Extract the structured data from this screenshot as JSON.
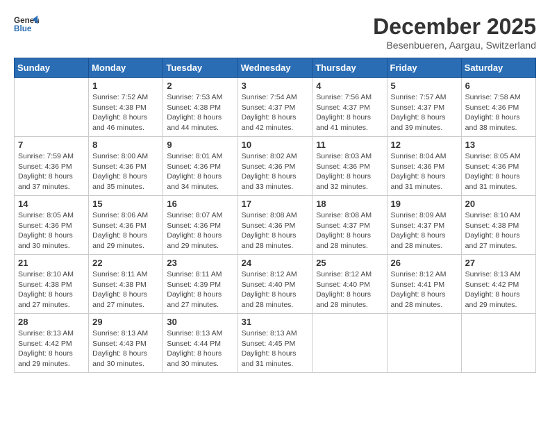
{
  "logo": {
    "line1": "General",
    "line2": "Blue"
  },
  "title": "December 2025",
  "location": "Besenbueren, Aargau, Switzerland",
  "days_of_week": [
    "Sunday",
    "Monday",
    "Tuesday",
    "Wednesday",
    "Thursday",
    "Friday",
    "Saturday"
  ],
  "weeks": [
    [
      {
        "day": "",
        "info": ""
      },
      {
        "day": "1",
        "info": "Sunrise: 7:52 AM\nSunset: 4:38 PM\nDaylight: 8 hours\nand 46 minutes."
      },
      {
        "day": "2",
        "info": "Sunrise: 7:53 AM\nSunset: 4:38 PM\nDaylight: 8 hours\nand 44 minutes."
      },
      {
        "day": "3",
        "info": "Sunrise: 7:54 AM\nSunset: 4:37 PM\nDaylight: 8 hours\nand 42 minutes."
      },
      {
        "day": "4",
        "info": "Sunrise: 7:56 AM\nSunset: 4:37 PM\nDaylight: 8 hours\nand 41 minutes."
      },
      {
        "day": "5",
        "info": "Sunrise: 7:57 AM\nSunset: 4:37 PM\nDaylight: 8 hours\nand 39 minutes."
      },
      {
        "day": "6",
        "info": "Sunrise: 7:58 AM\nSunset: 4:36 PM\nDaylight: 8 hours\nand 38 minutes."
      }
    ],
    [
      {
        "day": "7",
        "info": "Sunrise: 7:59 AM\nSunset: 4:36 PM\nDaylight: 8 hours\nand 37 minutes."
      },
      {
        "day": "8",
        "info": "Sunrise: 8:00 AM\nSunset: 4:36 PM\nDaylight: 8 hours\nand 35 minutes."
      },
      {
        "day": "9",
        "info": "Sunrise: 8:01 AM\nSunset: 4:36 PM\nDaylight: 8 hours\nand 34 minutes."
      },
      {
        "day": "10",
        "info": "Sunrise: 8:02 AM\nSunset: 4:36 PM\nDaylight: 8 hours\nand 33 minutes."
      },
      {
        "day": "11",
        "info": "Sunrise: 8:03 AM\nSunset: 4:36 PM\nDaylight: 8 hours\nand 32 minutes."
      },
      {
        "day": "12",
        "info": "Sunrise: 8:04 AM\nSunset: 4:36 PM\nDaylight: 8 hours\nand 31 minutes."
      },
      {
        "day": "13",
        "info": "Sunrise: 8:05 AM\nSunset: 4:36 PM\nDaylight: 8 hours\nand 31 minutes."
      }
    ],
    [
      {
        "day": "14",
        "info": "Sunrise: 8:05 AM\nSunset: 4:36 PM\nDaylight: 8 hours\nand 30 minutes."
      },
      {
        "day": "15",
        "info": "Sunrise: 8:06 AM\nSunset: 4:36 PM\nDaylight: 8 hours\nand 29 minutes."
      },
      {
        "day": "16",
        "info": "Sunrise: 8:07 AM\nSunset: 4:36 PM\nDaylight: 8 hours\nand 29 minutes."
      },
      {
        "day": "17",
        "info": "Sunrise: 8:08 AM\nSunset: 4:36 PM\nDaylight: 8 hours\nand 28 minutes."
      },
      {
        "day": "18",
        "info": "Sunrise: 8:08 AM\nSunset: 4:37 PM\nDaylight: 8 hours\nand 28 minutes."
      },
      {
        "day": "19",
        "info": "Sunrise: 8:09 AM\nSunset: 4:37 PM\nDaylight: 8 hours\nand 28 minutes."
      },
      {
        "day": "20",
        "info": "Sunrise: 8:10 AM\nSunset: 4:38 PM\nDaylight: 8 hours\nand 27 minutes."
      }
    ],
    [
      {
        "day": "21",
        "info": "Sunrise: 8:10 AM\nSunset: 4:38 PM\nDaylight: 8 hours\nand 27 minutes."
      },
      {
        "day": "22",
        "info": "Sunrise: 8:11 AM\nSunset: 4:38 PM\nDaylight: 8 hours\nand 27 minutes."
      },
      {
        "day": "23",
        "info": "Sunrise: 8:11 AM\nSunset: 4:39 PM\nDaylight: 8 hours\nand 27 minutes."
      },
      {
        "day": "24",
        "info": "Sunrise: 8:12 AM\nSunset: 4:40 PM\nDaylight: 8 hours\nand 28 minutes."
      },
      {
        "day": "25",
        "info": "Sunrise: 8:12 AM\nSunset: 4:40 PM\nDaylight: 8 hours\nand 28 minutes."
      },
      {
        "day": "26",
        "info": "Sunrise: 8:12 AM\nSunset: 4:41 PM\nDaylight: 8 hours\nand 28 minutes."
      },
      {
        "day": "27",
        "info": "Sunrise: 8:13 AM\nSunset: 4:42 PM\nDaylight: 8 hours\nand 29 minutes."
      }
    ],
    [
      {
        "day": "28",
        "info": "Sunrise: 8:13 AM\nSunset: 4:42 PM\nDaylight: 8 hours\nand 29 minutes."
      },
      {
        "day": "29",
        "info": "Sunrise: 8:13 AM\nSunset: 4:43 PM\nDaylight: 8 hours\nand 30 minutes."
      },
      {
        "day": "30",
        "info": "Sunrise: 8:13 AM\nSunset: 4:44 PM\nDaylight: 8 hours\nand 30 minutes."
      },
      {
        "day": "31",
        "info": "Sunrise: 8:13 AM\nSunset: 4:45 PM\nDaylight: 8 hours\nand 31 minutes."
      },
      {
        "day": "",
        "info": ""
      },
      {
        "day": "",
        "info": ""
      },
      {
        "day": "",
        "info": ""
      }
    ]
  ]
}
